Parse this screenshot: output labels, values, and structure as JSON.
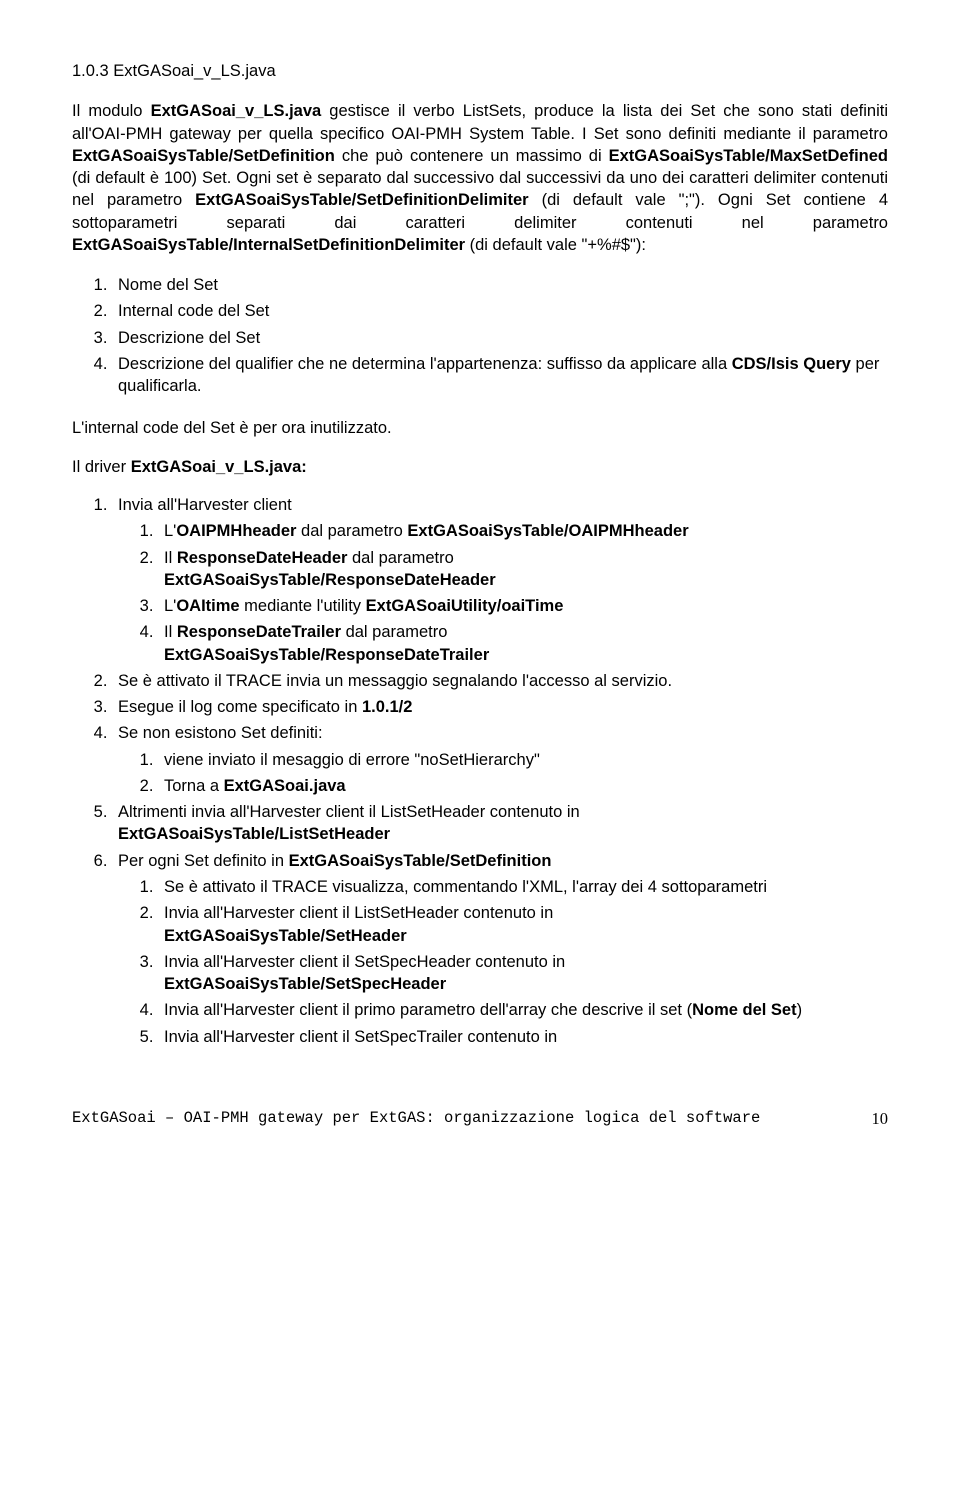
{
  "heading": "1.0.3 ExtGASoai_v_LS.java",
  "p1_a": "Il modulo ",
  "p1_b": "ExtGASoai_v_LS.java",
  "p1_c": " gestisce il verbo ListSets, produce la lista dei Set che sono stati definiti all'OAI-PMH gateway per quella specifico OAI-PMH System Table. I Set sono definiti mediante il parametro ",
  "p1_d": "ExtGASoaiSysTable/SetDefinition",
  "p1_e": " che può contenere un massimo di ",
  "p1_f": "ExtGASoaiSysTable/MaxSetDefined",
  "p1_g": " (di default è 100) Set. Ogni set è separato dal successivo dal successivi da uno dei caratteri delimiter contenuti nel parametro ",
  "p1_h": "ExtGASoaiSysTable/SetDefinitionDelimiter",
  "p1_i": " (di default vale \";\"). Ogni Set contiene 4 sottoparametri separati dai caratteri delimiter contenuti nel parametro ",
  "p1_j": "ExtGASoaiSysTable/InternalSetDefinitionDelimiter",
  "p1_k": " (di default vale \"+%#$\"):",
  "sub": {
    "i1": "Nome del Set",
    "i2": "Internal code del Set",
    "i3": "Descrizione del Set",
    "i4_a": "Descrizione del qualifier che ne determina l'appartenenza: suffisso da applicare alla ",
    "i4_b": "CDS/Isis Query",
    "i4_c": " per qualificarla."
  },
  "p2": "L'internal code del Set è per ora inutilizzato.",
  "p3_a": "Il driver ",
  "p3_b": "ExtGASoai_v_LS.java:",
  "d": {
    "n1": "Invia all'Harvester client",
    "n1_1_a": "L'",
    "n1_1_b": "OAIPMHheader",
    "n1_1_c": " dal parametro ",
    "n1_1_d": "ExtGASoaiSysTable/OAIPMHheader",
    "n1_2_a": "Il ",
    "n1_2_b": "ResponseDateHeader",
    "n1_2_c": " dal parametro ",
    "n1_2_d": "ExtGASoaiSysTable/ResponseDateHeader",
    "n1_3_a": "L'",
    "n1_3_b": "OAItime",
    "n1_3_c": " mediante l'utility ",
    "n1_3_d": "ExtGASoaiUtility/oaiTime",
    "n1_4_a": "Il ",
    "n1_4_b": "ResponseDateTrailer",
    "n1_4_c": " dal parametro ",
    "n1_4_d": "ExtGASoaiSysTable/ResponseDateTrailer",
    "n2": "Se è attivato il TRACE invia un messaggio segnalando l'accesso al servizio.",
    "n3_a": "Esegue il log come specificato in ",
    "n3_b": "1.0.1/2",
    "n4": "Se non esistono Set definiti:",
    "n4_1": "viene inviato il mesaggio di errore \"noSetHierarchy\"",
    "n4_2_a": "Torna a ",
    "n4_2_b": "ExtGASoai.java",
    "n5_a": "Altrimenti invia all'Harvester client il ListSetHeader contenuto in ",
    "n5_b": "ExtGASoaiSysTable/ListSetHeader",
    "n6_a": "Per ogni Set definito in ",
    "n6_b": "ExtGASoaiSysTable/SetDefinition",
    "n6_1": "Se è attivato il TRACE visualizza, commentando l'XML, l'array dei 4 sottoparametri",
    "n6_2_a": "Invia all'Harvester client il ListSetHeader contenuto in ",
    "n6_2_b": "ExtGASoaiSysTable/SetHeader",
    "n6_3_a": "Invia all'Harvester client il SetSpecHeader contenuto in ",
    "n6_3_b": "ExtGASoaiSysTable/SetSpecHeader",
    "n6_4_a": "Invia all'Harvester client il primo parametro dell'array che descrive il set (",
    "n6_4_b": "Nome del Set",
    "n6_4_c": ")",
    "n6_5": "Invia all'Harvester client il SetSpecTrailer contenuto in"
  },
  "footer_text": "ExtGASoai – OAI-PMH gateway per ExtGAS: organizzazione logica del software",
  "page_num": "10"
}
